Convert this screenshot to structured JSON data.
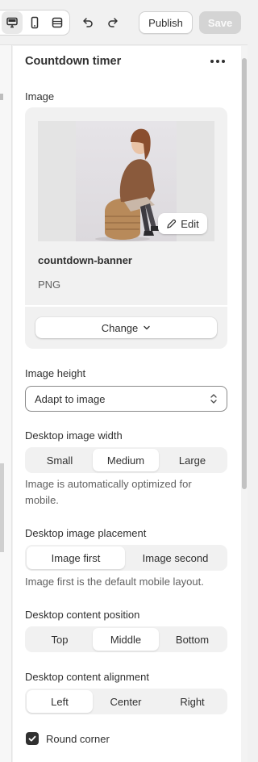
{
  "toolbar": {
    "view_buttons": [
      "desktop-icon",
      "mobile-icon",
      "fullscreen-icon"
    ],
    "undo_icon": "undo-icon",
    "redo_icon": "redo-icon",
    "publish_label": "Publish",
    "save_label": "Save"
  },
  "section": {
    "title": "Countdown timer",
    "more_icon": "more-horizontal-icon"
  },
  "image": {
    "label": "Image",
    "edit_label": "Edit",
    "file_name": "countdown-banner",
    "file_type": "PNG",
    "change_label": "Change"
  },
  "image_height": {
    "label": "Image height",
    "value": "Adapt to image"
  },
  "desktop_image_width": {
    "label": "Desktop image width",
    "options": [
      "Small",
      "Medium",
      "Large"
    ],
    "selected": "Medium",
    "help": "Image is automatically optimized for mobile."
  },
  "desktop_image_placement": {
    "label": "Desktop image placement",
    "options": [
      "Image first",
      "Image second"
    ],
    "selected": "Image first",
    "help": "Image first is the default mobile layout."
  },
  "desktop_content_position": {
    "label": "Desktop content position",
    "options": [
      "Top",
      "Middle",
      "Bottom"
    ],
    "selected": "Middle"
  },
  "desktop_content_alignment": {
    "label": "Desktop content alignment",
    "options": [
      "Left",
      "Center",
      "Right"
    ],
    "selected": "Left"
  },
  "round_corner": {
    "label": "Round corner",
    "checked": true
  },
  "colors": {
    "text": "#303030",
    "muted": "#616161",
    "save_disabled_bg": "#d4d4d4",
    "segment_bg": "#f1f1f1",
    "checkbox": "#303030"
  }
}
